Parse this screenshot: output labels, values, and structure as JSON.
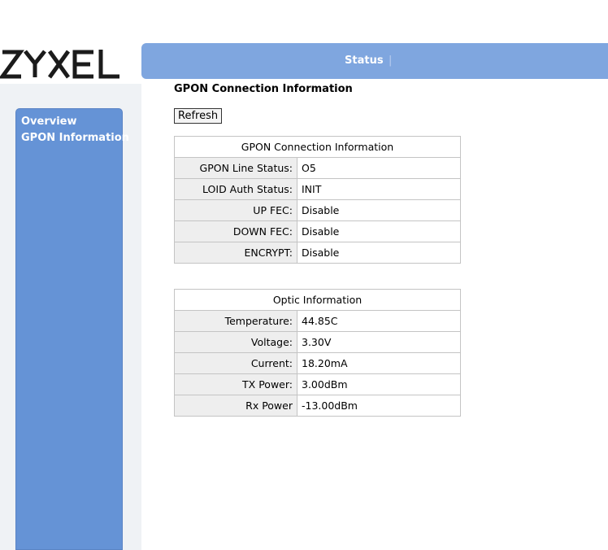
{
  "brand": {
    "logo_text": "ZYXEL"
  },
  "topnav": {
    "status_tab": "Status",
    "separator": "|"
  },
  "sidebar": {
    "items": [
      {
        "label": "Overview"
      },
      {
        "label": "GPON Information"
      }
    ]
  },
  "page": {
    "title": "GPON Connection Information",
    "refresh_label": "Refresh"
  },
  "gpon": {
    "header": "GPON Connection Information",
    "rows": [
      {
        "label": "GPON Line Status:",
        "value": "O5"
      },
      {
        "label": "LOID Auth Status:",
        "value": "INIT"
      },
      {
        "label": "UP FEC:",
        "value": "Disable"
      },
      {
        "label": "DOWN FEC:",
        "value": "Disable"
      },
      {
        "label": "ENCRYPT:",
        "value": "Disable"
      }
    ]
  },
  "optic": {
    "header": "Optic Information",
    "rows": [
      {
        "label": "Temperature:",
        "value": "44.85C"
      },
      {
        "label": "Voltage:",
        "value": "3.30V"
      },
      {
        "label": "Current:",
        "value": "18.20mA"
      },
      {
        "label": "TX Power:",
        "value": "3.00dBm"
      },
      {
        "label": "Rx Power",
        "value": "-13.00dBm"
      }
    ]
  },
  "colors": {
    "topbar": "#7fa6df",
    "sidebar": "#6593d6",
    "label_bg": "#eeeeee"
  }
}
